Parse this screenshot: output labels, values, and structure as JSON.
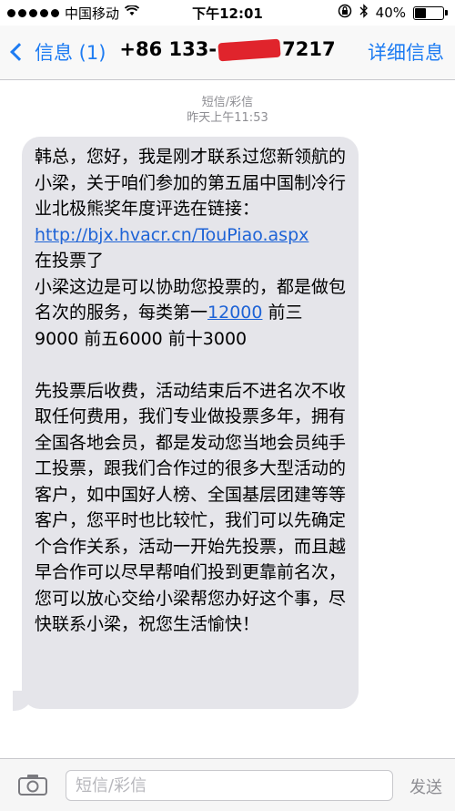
{
  "status_bar": {
    "carrier": "中国移动",
    "time": "下午12:01",
    "battery_percent": "40%",
    "battery_level": 0.4,
    "icons": [
      "signal-dots-icon",
      "wifi-icon",
      "rotation-lock-icon",
      "bluetooth-icon",
      "battery-icon"
    ]
  },
  "nav": {
    "back_label": "信息 (1)",
    "contact_prefix": "+86 133-",
    "contact_suffix": "7217",
    "details_label": "详细信息"
  },
  "thread": {
    "type_label": "短信/彩信",
    "timestamp": "昨天上午11:53"
  },
  "message": {
    "p1": "韩总，您好，我是刚才联系过您新领航的小梁，关于咱们参加的第五届中国制冷行业北极熊奖年度评选在链接：",
    "link1": "http://bjx.hvacr.cn/TouPiao.aspx",
    "p2": "\n在投票了\n小梁这边是可以协助您投票的，都是做包名次的服务，每类第一",
    "link2": "12000",
    "p3": " 前三9000 前五6000 前十3000\n\n先投票后收费，活动结束后不进名次不收取任何费用，我们专业做投票多年，拥有全国各地会员，都是发动您当地会员纯手工投票，跟我们合作过的很多大型活动的客户，如中国好人榜、全国基层团建等等客户，您平时也比较忙，我们可以先确定个合作关系，活动一开始先投票，而且越早合作可以尽早帮咱们投到更靠前名次，您可以放心交给小梁帮您办好这个事，尽快联系小梁，祝您生活愉快！"
  },
  "input_bar": {
    "placeholder": "短信/彩信",
    "send_label": "发送"
  },
  "colors": {
    "accent": "#1e7cf2",
    "bubble": "#e5e5ea",
    "redaction": "#e0242c"
  }
}
